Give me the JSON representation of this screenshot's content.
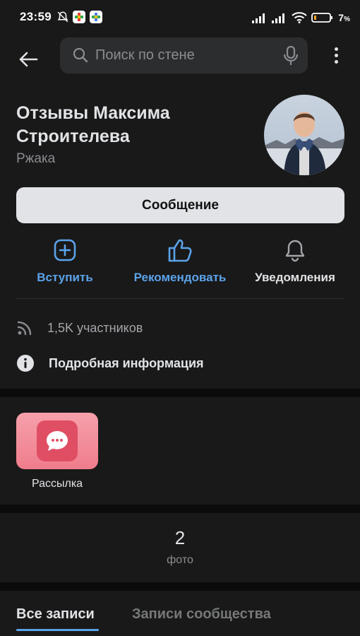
{
  "status_bar": {
    "time": "23:59",
    "battery_percent_text": "7",
    "battery_percent_sign": "%",
    "icons": [
      "bell-off-icon",
      "app-icon",
      "app-icon",
      "signal-icon",
      "signal-icon",
      "wifi-icon",
      "battery-icon"
    ]
  },
  "header": {
    "search_placeholder": "Поиск по стене",
    "icons": [
      "back-arrow-icon",
      "search-icon",
      "mic-icon",
      "more-vertical-icon"
    ]
  },
  "profile": {
    "name": "Отзывы Максима Строителева",
    "category": "Ржака",
    "message_button": "Сообщение"
  },
  "actions": [
    {
      "label": "Вступить",
      "icon": "plus-square-icon",
      "color": "#5ba3ea"
    },
    {
      "label": "Рекомендовать",
      "icon": "thumbs-up-icon",
      "color": "#5ba3ea"
    },
    {
      "label": "Уведомления",
      "icon": "bell-icon",
      "color": "#e1e3e6"
    }
  ],
  "info": {
    "members": "1,5K участников",
    "details": "Подробная информация"
  },
  "mailing": {
    "label": "Рассылка",
    "icon": "chat-bubble-icon"
  },
  "photos": {
    "count": "2",
    "label": "фото"
  },
  "tabs": [
    {
      "label": "Все записи",
      "active": true
    },
    {
      "label": "Записи сообщества",
      "active": false
    }
  ],
  "colors": {
    "accent": "#5ba3ea",
    "background": "#191919",
    "separator": "#0b0b0b",
    "mailing_tile": "#ef7d8c"
  }
}
